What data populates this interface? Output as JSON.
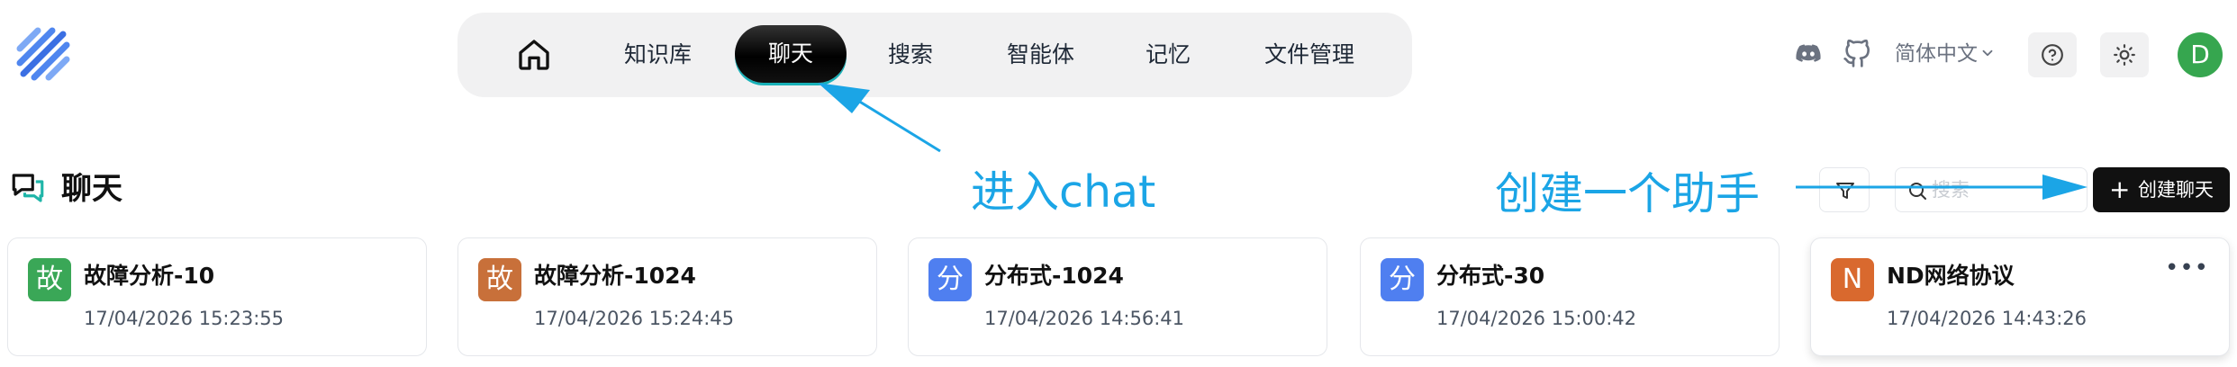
{
  "header": {
    "logo_icon": "diagonal-stripes-logo",
    "nav": {
      "home_icon": "home-icon",
      "items": [
        "知识库",
        "聊天",
        "搜索",
        "智能体",
        "记忆",
        "文件管理"
      ],
      "active": "聊天"
    },
    "language": "简体中文",
    "avatar_letter": "D"
  },
  "page": {
    "title": "聊天",
    "search_placeholder": "搜索",
    "create_button": "创建聊天"
  },
  "annotations": {
    "enter_chat": "进入chat",
    "create_assistant": "创建一个助手"
  },
  "cards": [
    {
      "avatar": "故",
      "avatar_color": "#3aa757",
      "title": "故障分析-10",
      "time": "17/04/2026 15:23:55"
    },
    {
      "avatar": "故",
      "avatar_color": "#c8703a",
      "title": "故障分析-1024",
      "time": "17/04/2026 15:24:45"
    },
    {
      "avatar": "分",
      "avatar_color": "#4f7ff0",
      "title": "分布式-1024",
      "time": "17/04/2026 14:56:41"
    },
    {
      "avatar": "分",
      "avatar_color": "#4f7ff0",
      "title": "分布式-30",
      "time": "17/04/2026 15:00:42"
    },
    {
      "avatar": "N",
      "avatar_color": "#d9692e",
      "title": "ND网络协议",
      "time": "17/04/2026 14:43:26"
    }
  ],
  "colors": {
    "annotation": "#1ba5e6",
    "active_nav_underline": "#19b1b8"
  }
}
